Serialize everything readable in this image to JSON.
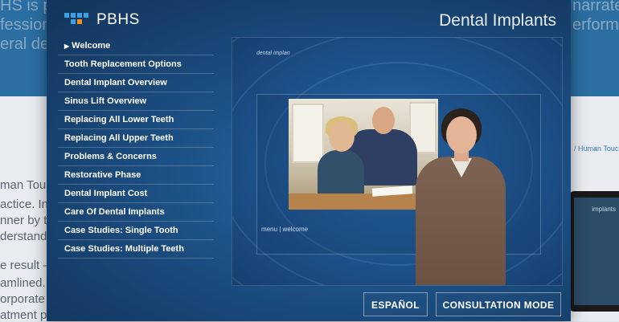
{
  "modal": {
    "brand": "PBHS",
    "title": "Dental Implants"
  },
  "menu": {
    "items": [
      {
        "label": "Welcome",
        "active": true
      },
      {
        "label": "Tooth Replacement Options"
      },
      {
        "label": "Dental Implant Overview"
      },
      {
        "label": "Sinus Lift Overview"
      },
      {
        "label": "Replacing All Lower Teeth"
      },
      {
        "label": "Replacing All Upper Teeth"
      },
      {
        "label": "Problems & Concerns"
      },
      {
        "label": "Restorative Phase"
      },
      {
        "label": "Dental Implant Cost"
      },
      {
        "label": "Care Of Dental Implants"
      },
      {
        "label": "Case Studies: Single Tooth"
      },
      {
        "label": "Case Studies: Multiple Teeth"
      }
    ]
  },
  "video": {
    "corner_label": "dental implan",
    "crumb": "menu | welcome"
  },
  "buttons": {
    "espanol": "ESPAÑOL",
    "consultation": "CONSULTATION MODE"
  },
  "background_page": {
    "line1": "HS is p",
    "line2": "fessiona",
    "line3": "eral de",
    "line4": "narrate",
    "line5": "erforme",
    "line6": "man Touc",
    "line7": "actice. Int",
    "line8": "nner by t",
    "line9": "derstand a",
    "line10": "e result –",
    "line11": "amlined.",
    "line12": "orporate",
    "line13": "atment p",
    "breadcrumb": "/ Human Touc",
    "tablet_text": "implants"
  },
  "colors": {
    "accent_orange": "#f28c1e",
    "accent_blue": "#3aa0e0",
    "modal_bg": "#1d5288"
  }
}
